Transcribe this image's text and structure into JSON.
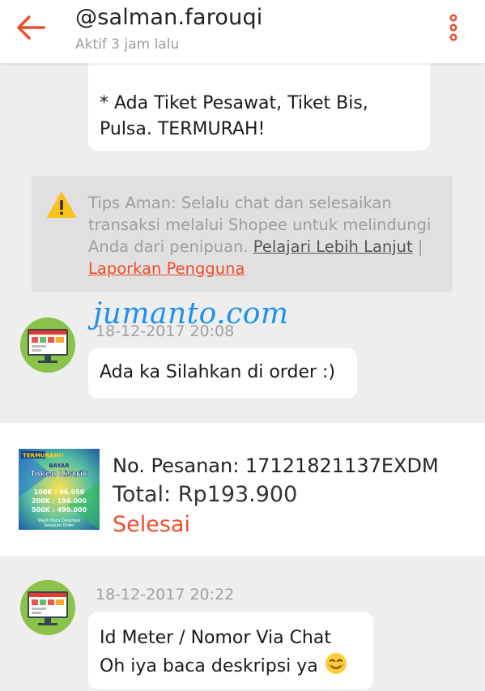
{
  "header": {
    "username": "@salman.farouqi",
    "last_active": "Aktif 3 jam lalu",
    "back_icon": "arrow-left-icon",
    "menu_icon": "more-vertical-icon",
    "accent_color": "#ee4d2d"
  },
  "messages": {
    "top_bubble": {
      "line1": "* Ada Tiket Pesawat, Tiket Bis,",
      "line2": "Pulsa. TERMURAH!"
    },
    "tips": {
      "icon": "warning-icon",
      "text": "Tips Aman: Selalu chat dan selesaikan transaksi melalui Shopee untuk melindungi Anda dari penipuan.",
      "learn_more": "Pelajari Lebih Lanjut",
      "separator": "|",
      "report": "Laporkan Pengguna"
    },
    "watermark": "jumanto.com",
    "msg1": {
      "timestamp": "18-12-2017 20:08",
      "text": "Ada ka Silahkan di order :)"
    },
    "order": {
      "number_label": "No. Pesanan: 17121821137EXDM",
      "total_label": "Total: Rp193.900",
      "status": "Selesai",
      "thumbnail": {
        "badge": "TERMURAH!!",
        "pre_title": "BAYAR",
        "title": "Token Listrik",
        "price_rows": [
          "100K : 96.950",
          "200K : 194.000",
          "500K : 490.000"
        ],
        "footer1": "Wajib Baca Deskripsi",
        "footer2": "Sebelum Order"
      }
    },
    "msg2": {
      "timestamp": "18-12-2017 20:22",
      "line1": "Id Meter / Nomor Via Chat",
      "line2": "Oh iya baca deskripsi ya",
      "emoji": "smiling-face-emoji"
    }
  }
}
